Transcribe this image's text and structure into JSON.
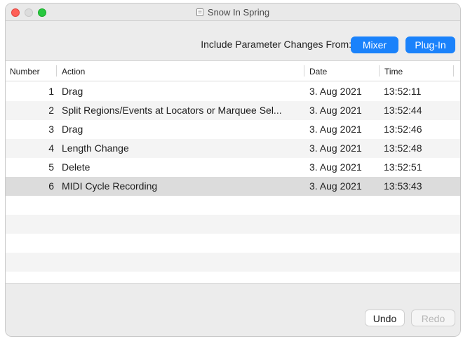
{
  "window": {
    "title": "Snow In Spring",
    "doc_icon": "document-icon"
  },
  "toolbar": {
    "include_label": "Include Parameter Changes From:",
    "mixer_label": "Mixer",
    "plugin_label": "Plug-In"
  },
  "table": {
    "columns": [
      "Number",
      "Action",
      "Date",
      "Time"
    ],
    "rows": [
      {
        "number": "1",
        "action": "Drag",
        "date": "3. Aug 2021",
        "time": "13:52:11"
      },
      {
        "number": "2",
        "action": "Split Regions/Events at Locators or Marquee Sel...",
        "date": "3. Aug 2021",
        "time": "13:52:44"
      },
      {
        "number": "3",
        "action": "Drag",
        "date": "3. Aug 2021",
        "time": "13:52:46"
      },
      {
        "number": "4",
        "action": "Length Change",
        "date": "3. Aug 2021",
        "time": "13:52:48"
      },
      {
        "number": "5",
        "action": "Delete",
        "date": "3. Aug 2021",
        "time": "13:52:51"
      },
      {
        "number": "6",
        "action": "MIDI Cycle Recording",
        "date": "3. Aug 2021",
        "time": "13:53:43"
      }
    ],
    "selected_row": 5
  },
  "footer": {
    "undo_label": "Undo",
    "redo_label": "Redo"
  },
  "colors": {
    "accent": "#1a82fb",
    "close": "#fe5f57",
    "maximize": "#28c840"
  }
}
